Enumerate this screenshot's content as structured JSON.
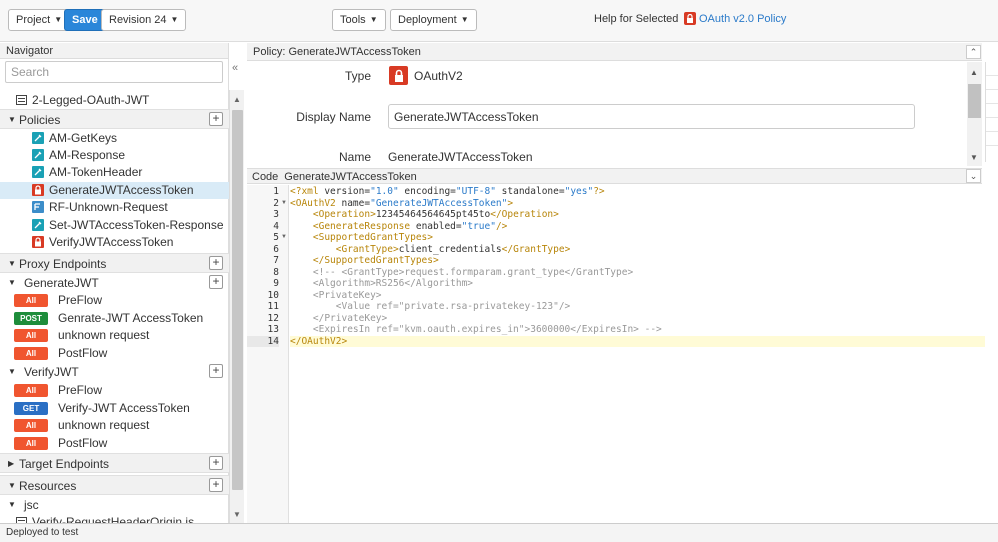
{
  "toolbar": {
    "project_label": "Project",
    "save_label": "Save",
    "revision_label": "Revision 24",
    "tools_label": "Tools",
    "deployment_label": "Deployment",
    "help_label": "Help for Selected",
    "help_link": "OAuth v2.0 Policy"
  },
  "navigator": {
    "title": "Navigator",
    "search_placeholder": "Search",
    "proxy_name": "2-Legged-OAuth-JWT",
    "policies_label": "Policies",
    "policies": [
      {
        "label": "AM-GetKeys",
        "icon": "assign-message-icon"
      },
      {
        "label": "AM-Response",
        "icon": "assign-message-icon"
      },
      {
        "label": "AM-TokenHeader",
        "icon": "assign-message-icon"
      },
      {
        "label": "GenerateJWTAccessToken",
        "icon": "oauth-lock-icon"
      },
      {
        "label": "RF-Unknown-Request",
        "icon": "raise-fault-icon"
      },
      {
        "label": "Set-JWTAccessToken-Response",
        "icon": "assign-message-icon"
      },
      {
        "label": "VerifyJWTAccessToken",
        "icon": "oauth-lock-icon"
      }
    ],
    "proxy_endpoints_label": "Proxy Endpoints",
    "generate_jwt": {
      "label": "GenerateJWT",
      "flows": [
        {
          "badge": "All",
          "label": "PreFlow"
        },
        {
          "badge": "POST",
          "label": "Genrate-JWT AccessToken"
        },
        {
          "badge": "All",
          "label": "unknown request"
        },
        {
          "badge": "All",
          "label": "PostFlow"
        }
      ]
    },
    "verify_jwt": {
      "label": "VerifyJWT",
      "flows": [
        {
          "badge": "All",
          "label": "PreFlow"
        },
        {
          "badge": "GET",
          "label": "Verify-JWT AccessToken"
        },
        {
          "badge": "All",
          "label": "unknown request"
        },
        {
          "badge": "All",
          "label": "PostFlow"
        }
      ]
    },
    "target_endpoints_label": "Target Endpoints",
    "resources_label": "Resources",
    "jsc_label": "jsc",
    "jsc_file": "Verify-RequestHeaderOrigin.js"
  },
  "policy": {
    "title": "Policy: GenerateJWTAccessToken",
    "type_label": "Type",
    "type_value": "OAuthV2",
    "display_name_label": "Display Name",
    "display_name_value": "GenerateJWTAccessToken",
    "name_label": "Name",
    "name_value": "GenerateJWTAccessToken"
  },
  "code": {
    "label": "Code",
    "file": "GenerateJWTAccessToken",
    "line_numbers": [
      "1",
      "2",
      "3",
      "4",
      "5",
      "6",
      "7",
      "8",
      "9",
      "10",
      "11",
      "12",
      "13",
      "14"
    ],
    "lines": [
      "<?xml version=\"1.0\" encoding=\"UTF-8\" standalone=\"yes\"?>",
      "<OAuthV2 name=\"GenerateJWTAccessToken\">",
      "    <Operation>12345464564645pt45to</Operation>",
      "    <GenerateResponse enabled=\"true\"/>",
      "    <SupportedGrantTypes>",
      "        <GrantType>client_credentials</GrantType>",
      "    </SupportedGrantTypes>",
      "    <!-- <GrantType>request.formparam.grant_type</GrantType>",
      "    <Algorithm>RS256</Algorithm>",
      "    <PrivateKey>",
      "        <Value ref=\"private.rsa-privatekey-123\"/>",
      "    </PrivateKey>",
      "    <ExpiresIn ref=\"kvm.oauth.expires_in\">3600000</ExpiresIn> -->",
      "</OAuthV2>"
    ],
    "active_line": 14
  },
  "status": {
    "text": "Deployed to test"
  },
  "colors": {
    "save_button": "#2a86d9",
    "badge_all": "#f0552f",
    "badge_post": "#1e8d3b",
    "badge_get": "#2a6fc4",
    "oauth_icon": "#d83a24",
    "assign_message_icon": "#1aa1b5",
    "selected_row": "#d9ebf7"
  }
}
